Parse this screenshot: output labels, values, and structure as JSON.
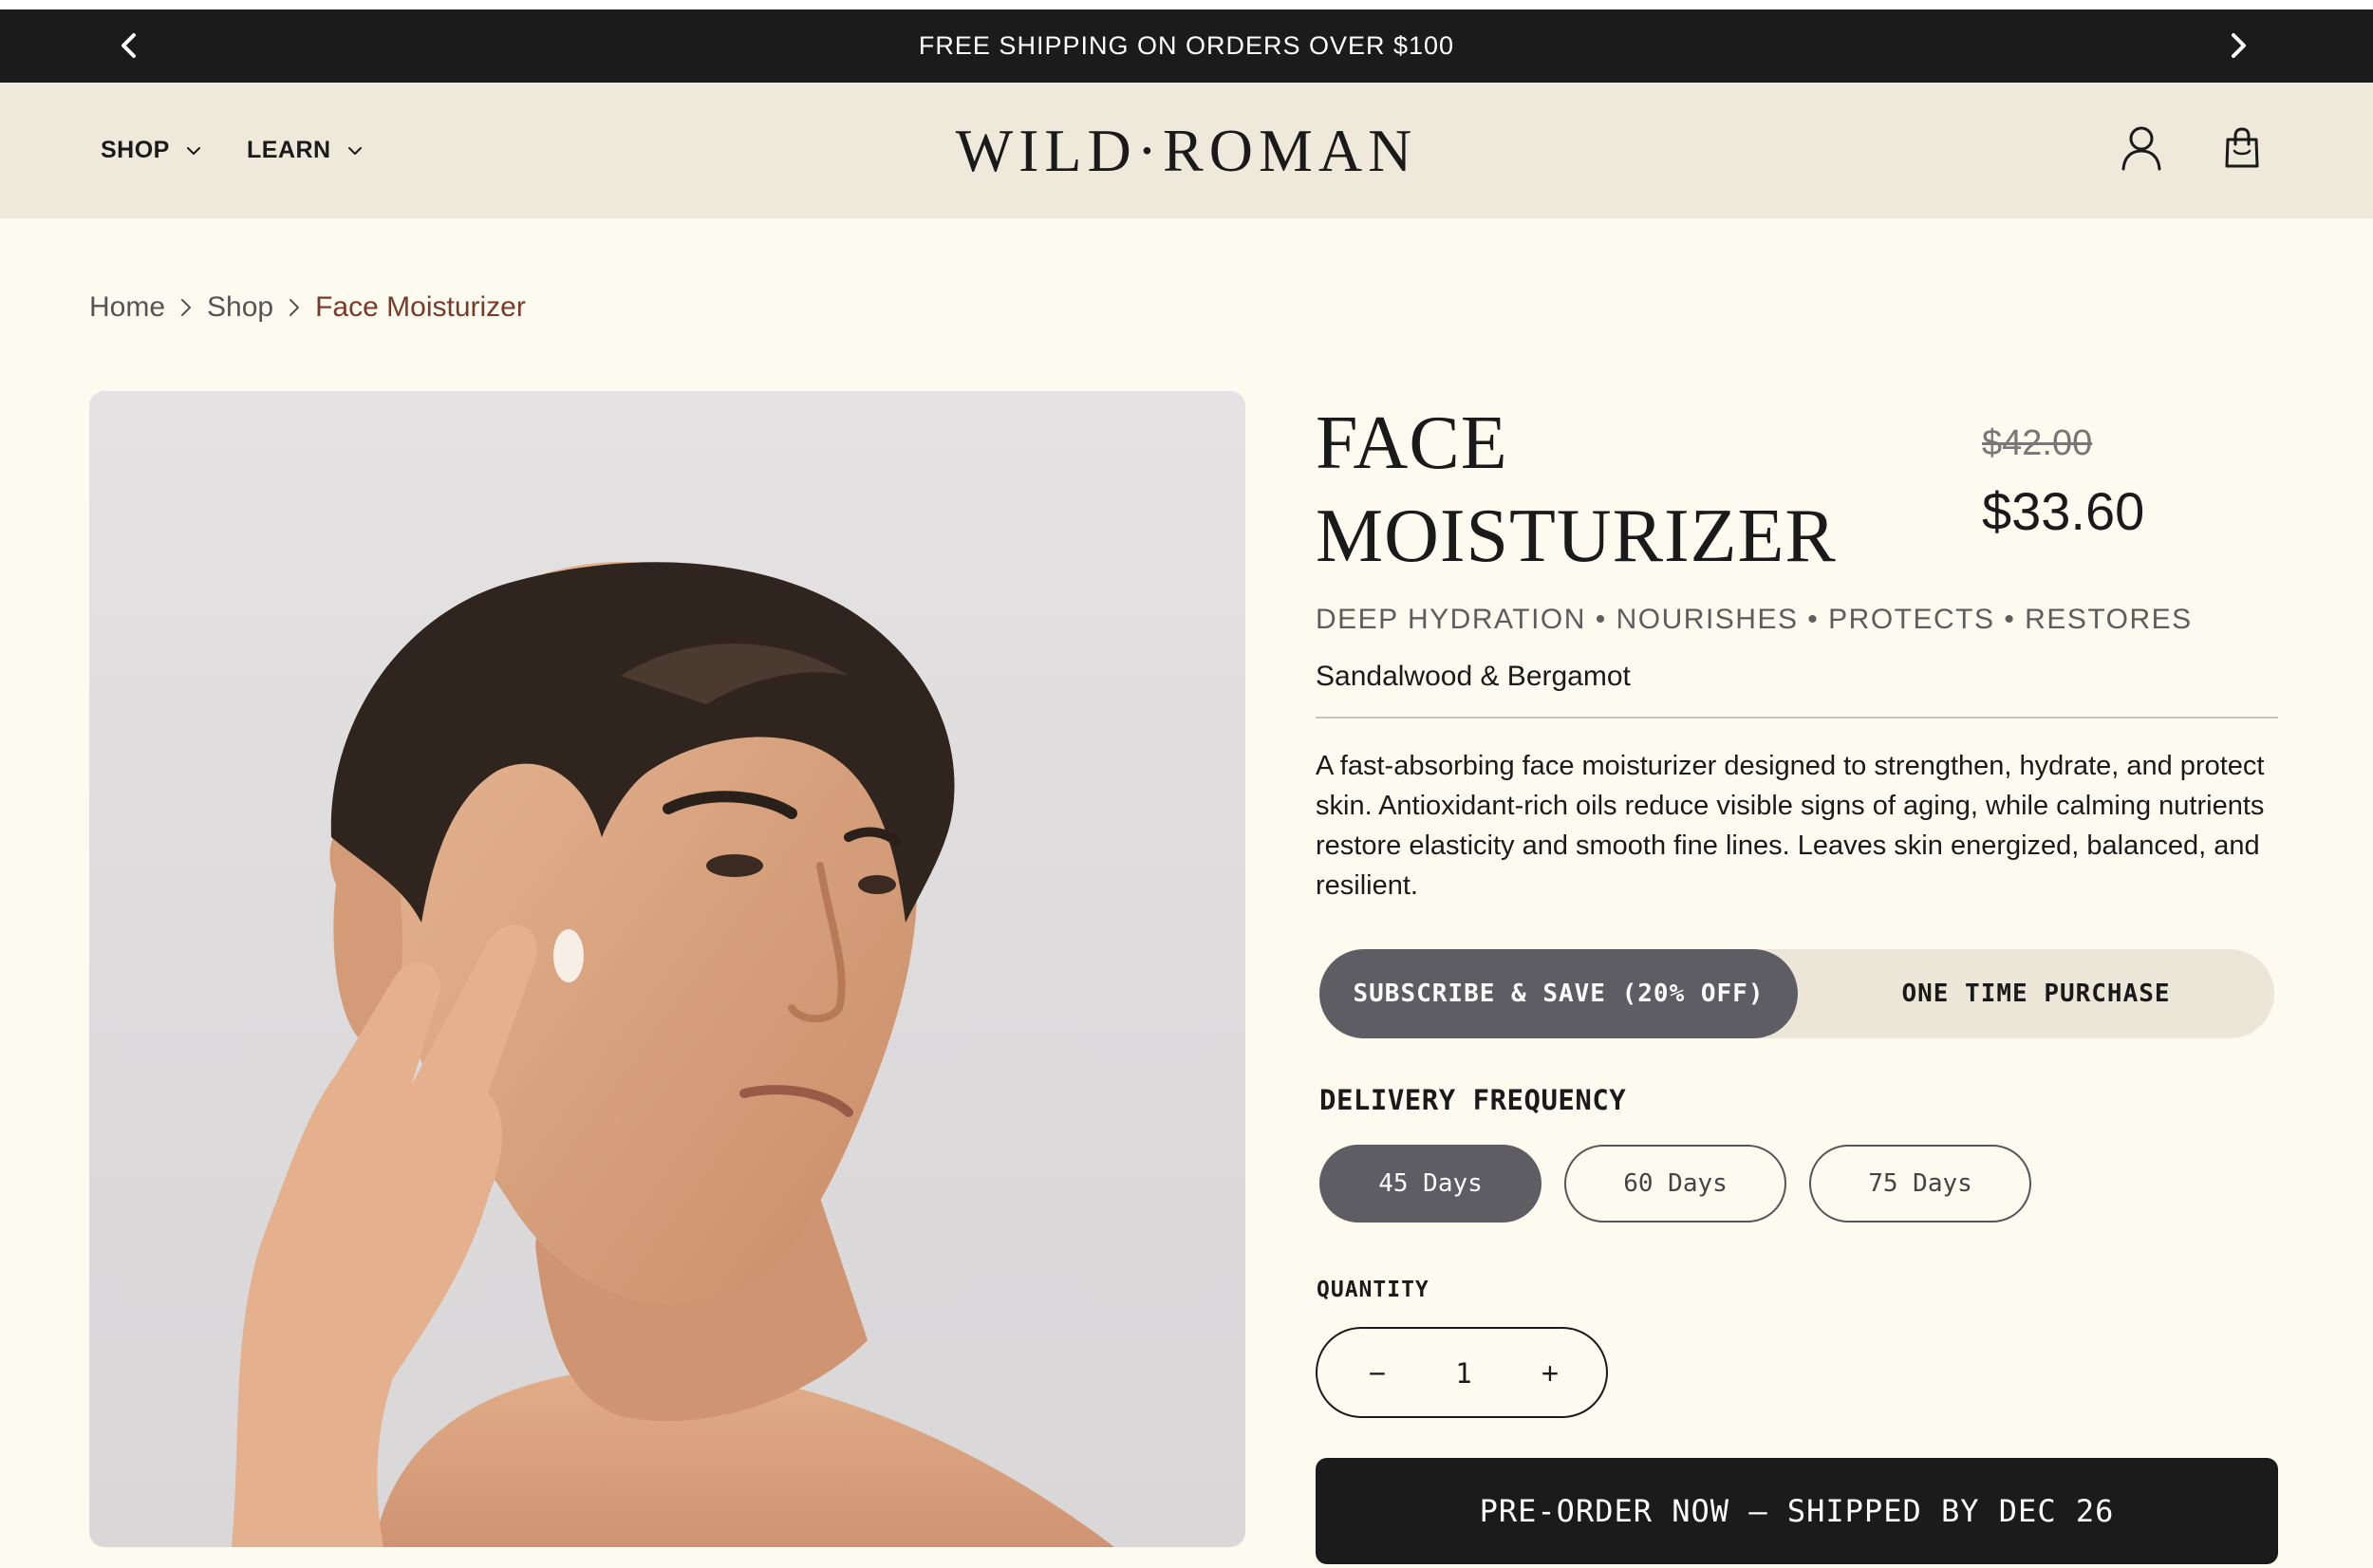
{
  "promo": {
    "text": "FREE SHIPPING ON ORDERS OVER $100",
    "prev_icon": "chevron-left-icon",
    "next_icon": "chevron-right-icon"
  },
  "header": {
    "nav": [
      {
        "label": "SHOP",
        "icon": "chevron-down-icon"
      },
      {
        "label": "LEARN",
        "icon": "chevron-down-icon"
      }
    ],
    "logo": "WILD·ROMAN",
    "icons": [
      "user-icon",
      "shopping-bag-icon"
    ]
  },
  "breadcrumb": {
    "items": [
      "Home",
      "Shop",
      "Face Moisturizer"
    ],
    "separator_icon": "chevron-right-icon"
  },
  "product": {
    "title": "FACE MOISTURIZER",
    "price_original": "$42.00",
    "price_sale": "$33.60",
    "benefits": "DEEP HYDRATION • NOURISHES • PROTECTS • RESTORES",
    "scent": "Sandalwood & Bergamot",
    "description": "A fast-absorbing face moisturizer designed to strengthen, hydrate, and protect skin. Antioxidant-rich oils reduce visible signs of aging, while calming nutrients restore elasticity and smooth fine lines. Leaves skin energized, balanced, and resilient."
  },
  "purchase_options": {
    "subscribe": "SUBSCRIBE & SAVE (20% OFF)",
    "one_time": "ONE TIME PURCHASE",
    "selected": "subscribe"
  },
  "delivery": {
    "label": "DELIVERY FREQUENCY",
    "options": [
      "45 Days",
      "60 Days",
      "75 Days"
    ],
    "selected": "45 Days"
  },
  "quantity": {
    "label": "QUANTITY",
    "minus": "−",
    "value": "1",
    "plus": "+"
  },
  "cta": {
    "label": "PRE-ORDER NOW – SHIPPED BY DEC 26"
  },
  "colors": {
    "page_bg": "#fdfaf0",
    "header_bg": "#efe9dc",
    "promo_bg": "#1b1b1b",
    "selected_pill": "#5d5d63",
    "breadcrumb_current": "#7a3a2a"
  }
}
